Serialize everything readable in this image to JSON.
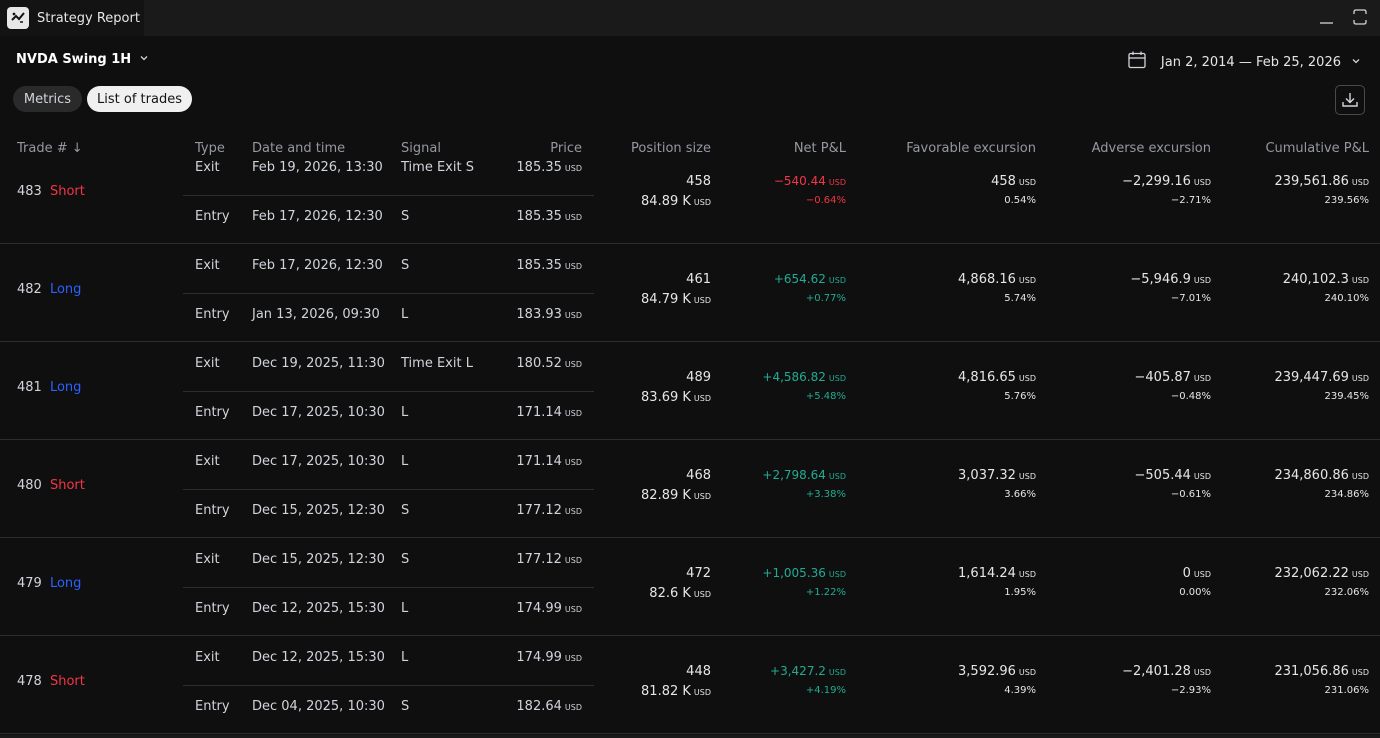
{
  "window": {
    "tab_title": "Strategy Report"
  },
  "header": {
    "strategy_name": "NVDA Swing 1H",
    "date_range": "Jan 2, 2014 — Feb 25, 2026",
    "tabs": [
      {
        "label": "Metrics",
        "active": false
      },
      {
        "label": "List of trades",
        "active": true
      }
    ]
  },
  "columns": {
    "trade": "Trade # ↓",
    "type": "Type",
    "datetime": "Date and time",
    "signal": "Signal",
    "price": "Price",
    "position_size": "Position size",
    "net_pl": "Net P&L",
    "favorable": "Favorable excursion",
    "adverse": "Adverse excursion",
    "cumulative": "Cumulative P&L"
  },
  "currency": "USD",
  "colors": {
    "short": "#f23645",
    "long": "#2962ff",
    "profit": "#22ab94",
    "loss": "#f23645"
  },
  "trades": [
    {
      "num": "483",
      "side": "Short",
      "exit": {
        "type": "Exit",
        "datetime": "Feb 19, 2026, 13:30",
        "signal": "Time Exit S",
        "price": "185.35"
      },
      "entry": {
        "type": "Entry",
        "datetime": "Feb 17, 2026, 12:30",
        "signal": "S",
        "price": "185.35"
      },
      "qty": "458",
      "value": "84.89 K",
      "net": "−540.44",
      "net_pct": "−0.64%",
      "net_sign": "neg",
      "fav": "458",
      "fav_pct": "0.54%",
      "adv": "−2,299.16",
      "adv_pct": "−2.71%",
      "cum": "239,561.86",
      "cum_pct": "239.56%"
    },
    {
      "num": "482",
      "side": "Long",
      "exit": {
        "type": "Exit",
        "datetime": "Feb 17, 2026, 12:30",
        "signal": "S",
        "price": "185.35"
      },
      "entry": {
        "type": "Entry",
        "datetime": "Jan 13, 2026, 09:30",
        "signal": "L",
        "price": "183.93"
      },
      "qty": "461",
      "value": "84.79 K",
      "net": "+654.62",
      "net_pct": "+0.77%",
      "net_sign": "pos",
      "fav": "4,868.16",
      "fav_pct": "5.74%",
      "adv": "−5,946.9",
      "adv_pct": "−7.01%",
      "cum": "240,102.3",
      "cum_pct": "240.10%"
    },
    {
      "num": "481",
      "side": "Long",
      "exit": {
        "type": "Exit",
        "datetime": "Dec 19, 2025, 11:30",
        "signal": "Time Exit L",
        "price": "180.52"
      },
      "entry": {
        "type": "Entry",
        "datetime": "Dec 17, 2025, 10:30",
        "signal": "L",
        "price": "171.14"
      },
      "qty": "489",
      "value": "83.69 K",
      "net": "+4,586.82",
      "net_pct": "+5.48%",
      "net_sign": "pos",
      "fav": "4,816.65",
      "fav_pct": "5.76%",
      "adv": "−405.87",
      "adv_pct": "−0.48%",
      "cum": "239,447.69",
      "cum_pct": "239.45%"
    },
    {
      "num": "480",
      "side": "Short",
      "exit": {
        "type": "Exit",
        "datetime": "Dec 17, 2025, 10:30",
        "signal": "L",
        "price": "171.14"
      },
      "entry": {
        "type": "Entry",
        "datetime": "Dec 15, 2025, 12:30",
        "signal": "S",
        "price": "177.12"
      },
      "qty": "468",
      "value": "82.89 K",
      "net": "+2,798.64",
      "net_pct": "+3.38%",
      "net_sign": "pos",
      "fav": "3,037.32",
      "fav_pct": "3.66%",
      "adv": "−505.44",
      "adv_pct": "−0.61%",
      "cum": "234,860.86",
      "cum_pct": "234.86%"
    },
    {
      "num": "479",
      "side": "Long",
      "exit": {
        "type": "Exit",
        "datetime": "Dec 15, 2025, 12:30",
        "signal": "S",
        "price": "177.12"
      },
      "entry": {
        "type": "Entry",
        "datetime": "Dec 12, 2025, 15:30",
        "signal": "L",
        "price": "174.99"
      },
      "qty": "472",
      "value": "82.6 K",
      "net": "+1,005.36",
      "net_pct": "+1.22%",
      "net_sign": "pos",
      "fav": "1,614.24",
      "fav_pct": "1.95%",
      "adv": "0",
      "adv_pct": "0.00%",
      "cum": "232,062.22",
      "cum_pct": "232.06%"
    },
    {
      "num": "478",
      "side": "Short",
      "exit": {
        "type": "Exit",
        "datetime": "Dec 12, 2025, 15:30",
        "signal": "L",
        "price": "174.99"
      },
      "entry": {
        "type": "Entry",
        "datetime": "Dec 04, 2025, 10:30",
        "signal": "S",
        "price": "182.64"
      },
      "qty": "448",
      "value": "81.82 K",
      "net": "+3,427.2",
      "net_pct": "+4.19%",
      "net_sign": "pos",
      "fav": "3,592.96",
      "fav_pct": "4.39%",
      "adv": "−2,401.28",
      "adv_pct": "−2.93%",
      "cum": "231,056.86",
      "cum_pct": "231.06%"
    }
  ]
}
